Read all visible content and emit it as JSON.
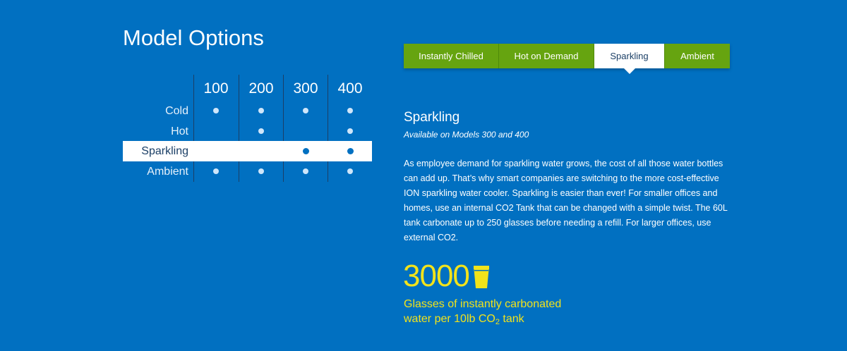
{
  "title": "Model Options",
  "matrix": {
    "columns": [
      "100",
      "200",
      "300",
      "400"
    ],
    "rows": [
      {
        "label": "Cold",
        "available": [
          true,
          true,
          true,
          true
        ],
        "highlighted": false
      },
      {
        "label": "Hot",
        "available": [
          false,
          true,
          false,
          true
        ],
        "highlighted": false
      },
      {
        "label": "Sparkling",
        "available": [
          false,
          false,
          true,
          true
        ],
        "highlighted": true
      },
      {
        "label": "Ambient",
        "available": [
          true,
          true,
          true,
          true
        ],
        "highlighted": false
      }
    ]
  },
  "tabs": [
    {
      "label": "Instantly Chilled",
      "active": false
    },
    {
      "label": "Hot on Demand",
      "active": false
    },
    {
      "label": "Sparkling",
      "active": true
    },
    {
      "label": "Ambient",
      "active": false
    }
  ],
  "detail": {
    "title": "Sparkling",
    "subtitle": "Available on Models 300 and 400",
    "body": "As employee demand for sparkling water grows, the cost of all those water bottles can add up. That’s why smart companies are switching to the more cost-effective ION sparkling water cooler.  Sparkling is easier than ever!  For smaller offices and homes, use an internal CO2 Tank that can be changed with a simple twist.  The 60L tank carbonate up to 250 glasses before needing a refill.  For larger offices, use external CO2."
  },
  "stat": {
    "number": "3000",
    "caption_line1": "Glasses of instantly carbonated",
    "caption_line2_prefix": "water per 10lb CO",
    "caption_line2_sub": "2",
    "caption_line2_suffix": " tank",
    "icon": "cup-icon"
  },
  "colors": {
    "background": "#0170c1",
    "tab_green": "#66a410",
    "accent_yellow": "#f2e31b",
    "row_highlight": "#ffffff"
  }
}
